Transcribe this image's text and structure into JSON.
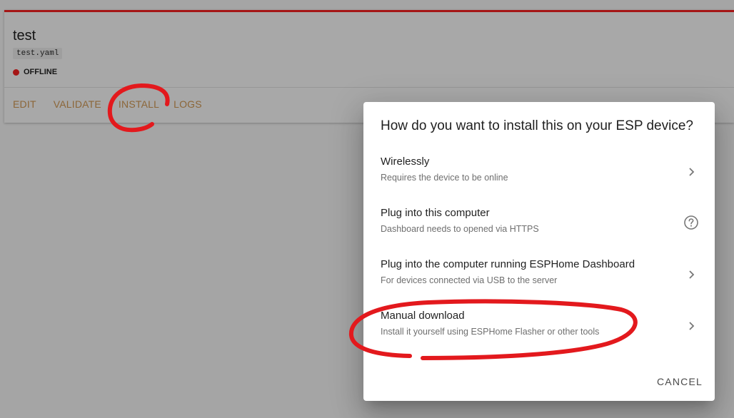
{
  "device": {
    "name": "test",
    "file": "test.yaml",
    "status": "OFFLINE",
    "status_color": "#a51616",
    "actions": [
      "EDIT",
      "VALIDATE",
      "INSTALL",
      "LOGS"
    ]
  },
  "dialog": {
    "title": "How do you want to install this on your ESP device?",
    "options": [
      {
        "label": "Wirelessly",
        "desc": "Requires the device to be online",
        "icon": "chevron-right-icon"
      },
      {
        "label": "Plug into this computer",
        "desc": "Dashboard needs to opened via HTTPS",
        "icon": "help-circle-icon"
      },
      {
        "label": "Plug into the computer running ESPHome Dashboard",
        "desc": "For devices connected via USB to the server",
        "icon": "chevron-right-icon"
      },
      {
        "label": "Manual download",
        "desc": "Install it yourself using ESPHome Flasher or other tools",
        "icon": "chevron-right-icon"
      }
    ],
    "cancel_label": "CANCEL"
  },
  "colors": {
    "accent": "#8c6638",
    "annotation": "#e3191d"
  }
}
